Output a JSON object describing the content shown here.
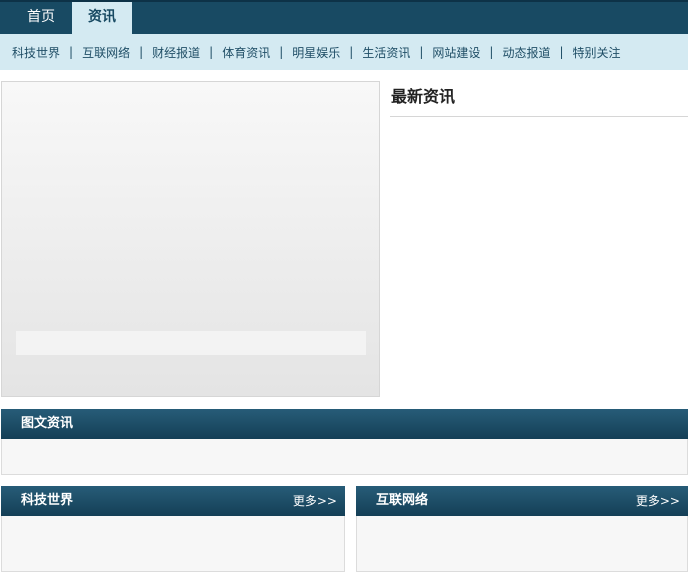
{
  "topnav": {
    "home": "首页",
    "news": "资讯"
  },
  "subnav": {
    "items": [
      "科技世界",
      "互联网络",
      "财经报道",
      "体育资讯",
      "明星娱乐",
      "生活资讯",
      "网站建设",
      "动态报道",
      "特别关注"
    ],
    "separator": "|"
  },
  "latest": {
    "title": "最新资讯"
  },
  "sections": {
    "pictures": {
      "title": "图文资讯"
    },
    "tech": {
      "title": "科技世界",
      "more": "更多>>"
    },
    "net": {
      "title": "互联网络",
      "more": "更多>>"
    }
  },
  "colors": {
    "nav_dark": "#184a63",
    "nav_light": "#d4eaf2"
  }
}
